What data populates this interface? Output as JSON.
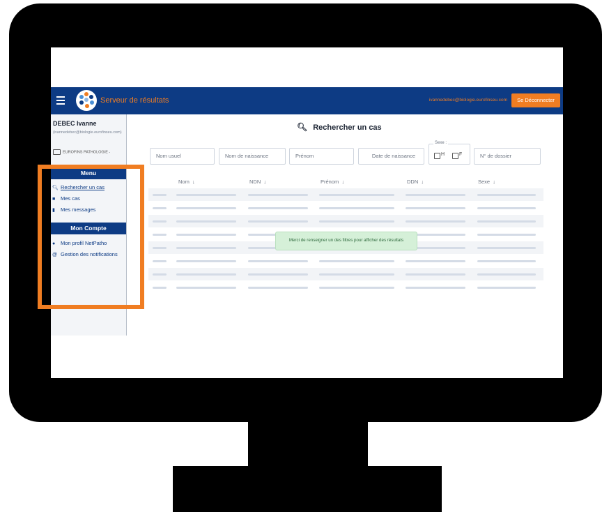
{
  "header": {
    "title": "Serveur de résultats",
    "user_email": "ivannedebec@biologie.eurofinseu.com",
    "logout_label": "Se Déconnecter"
  },
  "sidebar": {
    "user_name": "DEBEC Ivanne",
    "user_email": "(ivannedebec@biologie.eurofinseu.com)",
    "organization": "EUROFINS PATHOLOGIE -",
    "sections": [
      {
        "title": "Menu",
        "items": [
          {
            "icon": "search-icon",
            "label": "Rechercher un cas"
          },
          {
            "icon": "folder-icon",
            "label": "Mes cas"
          },
          {
            "icon": "message-icon",
            "label": "Mes messages"
          }
        ]
      },
      {
        "title": "Mon Compte",
        "items": [
          {
            "icon": "users-icon",
            "label": "Mon profil NetPatho"
          },
          {
            "icon": "at-icon",
            "label": "Gestion des notifications"
          }
        ]
      }
    ]
  },
  "search": {
    "title": "Rechercher un cas",
    "filters": {
      "nom_usuel": "Nom usuel",
      "nom_naissance": "Nom de naissance",
      "prenom": "Prénom",
      "date_naissance": "Date de naissance",
      "sexe_label": "Sexe :",
      "sexe_h": "H",
      "sexe_f": "F",
      "dossier": "N° de dossier"
    }
  },
  "table": {
    "columns": [
      "Nom",
      "NDN",
      "Prénom",
      "DDN",
      "Sexe"
    ],
    "sort_icon": "arrow-down-icon",
    "loading_rows": 8
  },
  "message": "Merci de renseigner un des filtres pour afficher des résultats",
  "colors": {
    "header_bg": "#0d3b84",
    "accent": "#f07d22",
    "toast_bg": "#d5f0d8",
    "highlight": "#f07d22"
  }
}
